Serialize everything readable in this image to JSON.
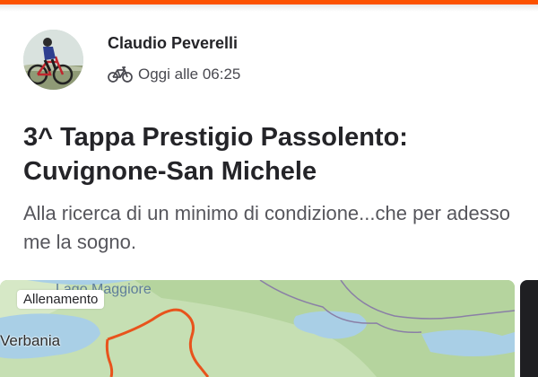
{
  "colors": {
    "accent": "#fc5200",
    "route": "#e8531c",
    "map_land": "#c6dfb3",
    "map_water": "#a9cfe6"
  },
  "activity": {
    "athlete_name": "Claudio Peverelli",
    "type_icon": "bike-icon",
    "timestamp": "Oggi alle 06:25",
    "title": "3^ Tappa Prestigio Passolento: Cuvignone-San Michele",
    "description": "Alla ricerca di un minimo di condizione...che per adesso me la sogno."
  },
  "map": {
    "tag": "Allenamento",
    "lake_label": "Lago Maggiore",
    "town_label": "Verbania"
  }
}
